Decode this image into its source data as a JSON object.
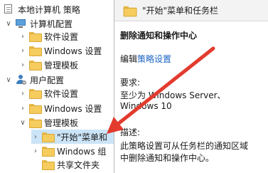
{
  "tree": {
    "root": {
      "label": "本地计算机 策略"
    },
    "computer_config": {
      "label": "计算机配置"
    },
    "items_cc": [
      {
        "label": "软件设置"
      },
      {
        "label": "Windows 设置"
      },
      {
        "label": "管理模板"
      }
    ],
    "user_config": {
      "label": "用户配置"
    },
    "items_uc": [
      {
        "label": "软件设置"
      },
      {
        "label": "Windows 设置"
      },
      {
        "label": "管理模板"
      }
    ],
    "admin_children": [
      {
        "label": "\"开始\"菜单和"
      },
      {
        "label": "Windows 组"
      },
      {
        "label": "共享文件夹"
      }
    ]
  },
  "detail": {
    "header_title": "\"开始\"菜单和任务栏",
    "policy_title": "删除通知和操作中心",
    "edit_prefix": "编辑",
    "edit_link": "策略设置",
    "requirements_label": "要求:",
    "requirements_line1": "至少为 Windows Server、",
    "requirements_line2": "Windows 10",
    "description_label": "描述:",
    "description_line1": "此策略设置可从任务栏的通知区域",
    "description_line2": "中删除通知和操作中心。"
  },
  "colors": {
    "selection": "#cce4f7",
    "link": "#1a63c6",
    "arrow": "#e23b2e",
    "folder": "#f5cc5d"
  }
}
